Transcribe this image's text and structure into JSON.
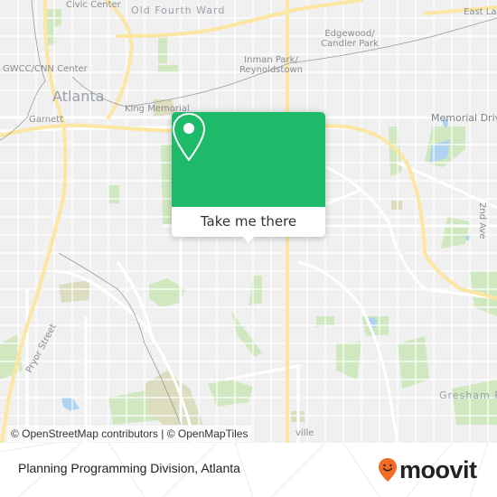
{
  "map": {
    "labels": {
      "civic_center": "Civic Center",
      "old_fourth_ward": "Old Fourth Ward",
      "east_lake": "East Lake",
      "edgewood_1": "Edgewood/",
      "edgewood_2": "Candler Park",
      "gwcc": "GWCC/CNN Center",
      "inman_1": "Inman Park/",
      "inman_2": "Reynoldstown",
      "atlanta": "Atlanta",
      "garnett": "Garnett",
      "king_memorial": "King Memorial",
      "memorial_drive": "Memorial Drive",
      "second_ave": "2nd Ave",
      "pryor_street": "Pryor Street",
      "gresham_park": "Gresham Park",
      "ville": "ville"
    },
    "colors": {
      "background": "#f0f0f1",
      "road": "#ffffff",
      "highway": "#fbe6a2",
      "park": "#cfe8bf",
      "cemetery": "#dcdcbf",
      "water": "#aed3f0",
      "rail": "#9a9a9a"
    }
  },
  "popup": {
    "icon": "location-pin-icon",
    "button_label": "Take me there",
    "accent": "#1dba69"
  },
  "attribution": "© OpenStreetMap contributors | © OpenMapTiles",
  "footer": {
    "title": "Planning Programming Division, Atlanta",
    "brand": "moovit",
    "brand_color": "#f26a23"
  }
}
